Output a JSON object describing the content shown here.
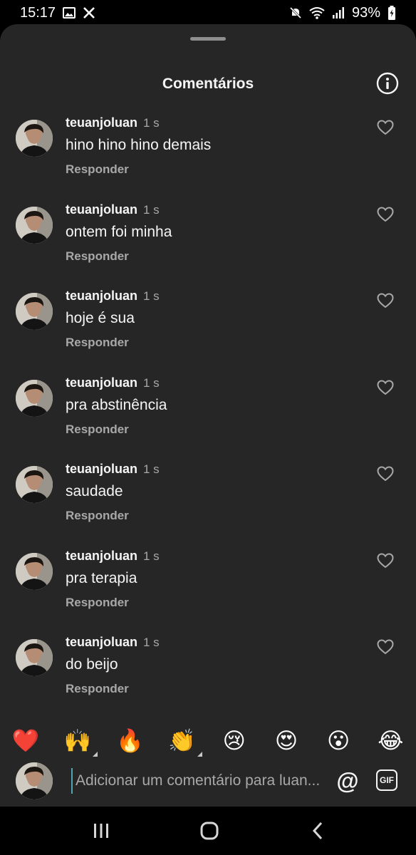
{
  "status_bar": {
    "time": "15:17",
    "battery": "93%",
    "icons_left": [
      "gallery-icon",
      "x-logo-icon"
    ],
    "icons_right": [
      "mute-icon",
      "wifi-icon",
      "signal-icon",
      "battery-charging-icon"
    ]
  },
  "sheet": {
    "title": "Comentários",
    "info_icon": "info-icon"
  },
  "comments": [
    {
      "username": "teuanjoluan",
      "time": "1 s",
      "text": "hino hino hino demais",
      "reply_label": "Responder"
    },
    {
      "username": "teuanjoluan",
      "time": "1 s",
      "text": "ontem foi minha",
      "reply_label": "Responder"
    },
    {
      "username": "teuanjoluan",
      "time": "1 s",
      "text": "hoje é sua",
      "reply_label": "Responder"
    },
    {
      "username": "teuanjoluan",
      "time": "1 s",
      "text": "pra abstinência",
      "reply_label": "Responder"
    },
    {
      "username": "teuanjoluan",
      "time": "1 s",
      "text": "saudade",
      "reply_label": "Responder"
    },
    {
      "username": "teuanjoluan",
      "time": "1 s",
      "text": "pra terapia",
      "reply_label": "Responder"
    },
    {
      "username": "teuanjoluan",
      "time": "1 s",
      "text": "do beijo",
      "reply_label": "Responder"
    }
  ],
  "reactions": [
    "❤️",
    "🙌",
    "🔥",
    "👏",
    "😢",
    "😍",
    "😮",
    "😂"
  ],
  "composer": {
    "placeholder": "Adicionar um comentário para luan...",
    "mention_label": "@",
    "gif_label": "GIF"
  },
  "colors": {
    "sheet_background": "#262626",
    "secondary_text": "#a8a8a8",
    "cursor": "#4fa6b0"
  }
}
